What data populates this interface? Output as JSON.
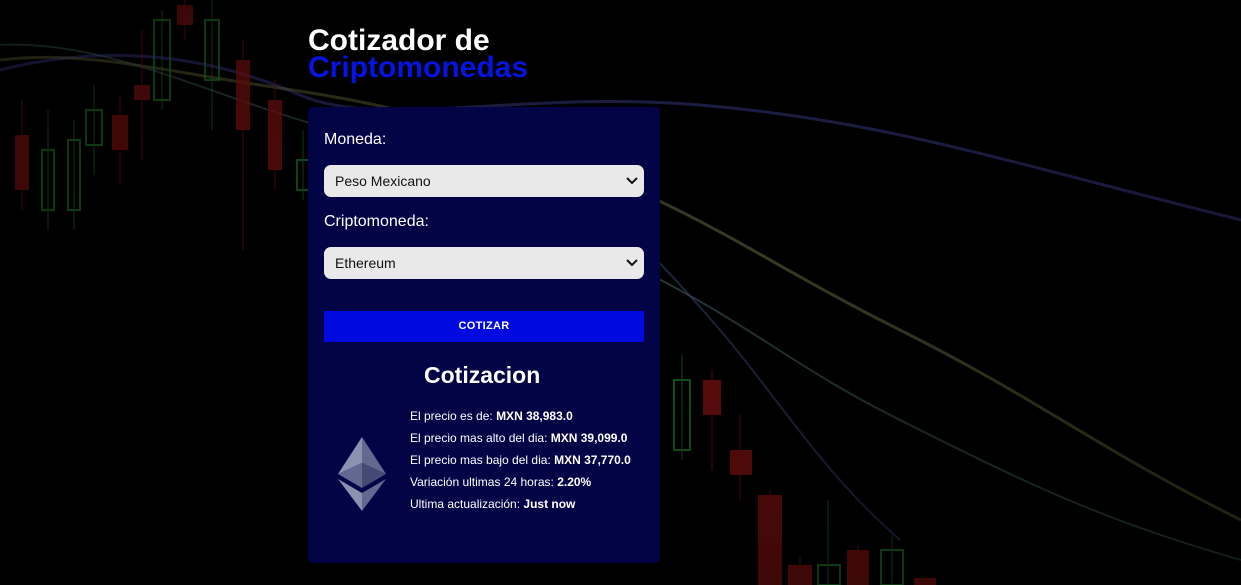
{
  "header": {
    "title_line1": "Cotizador de",
    "title_line2": "Criptomonedas"
  },
  "form": {
    "currency_label": "Moneda:",
    "currency_selected": "Peso Mexicano",
    "crypto_label": "Criptomoneda:",
    "crypto_selected": "Ethereum",
    "submit_label": "COTIZAR"
  },
  "result": {
    "title": "Cotizacion",
    "coin_icon": "ethereum-logo-icon",
    "price_label": "El precio es de:",
    "price_value": "MXN 38,983.0",
    "high_label": "El precio mas alto del dia:",
    "high_value": "MXN 39,099.0",
    "low_label": "El precio mas bajo del dia:",
    "low_value": "MXN 37,770.0",
    "change_label": "Variación ultimas 24 horas:",
    "change_value": "2.20%",
    "updated_label": "Ultima actualización:",
    "updated_value": "Just now"
  },
  "colors": {
    "background": "#000000",
    "card": "#020446",
    "accent": "#0009e0",
    "title_accent": "#0514e0"
  }
}
